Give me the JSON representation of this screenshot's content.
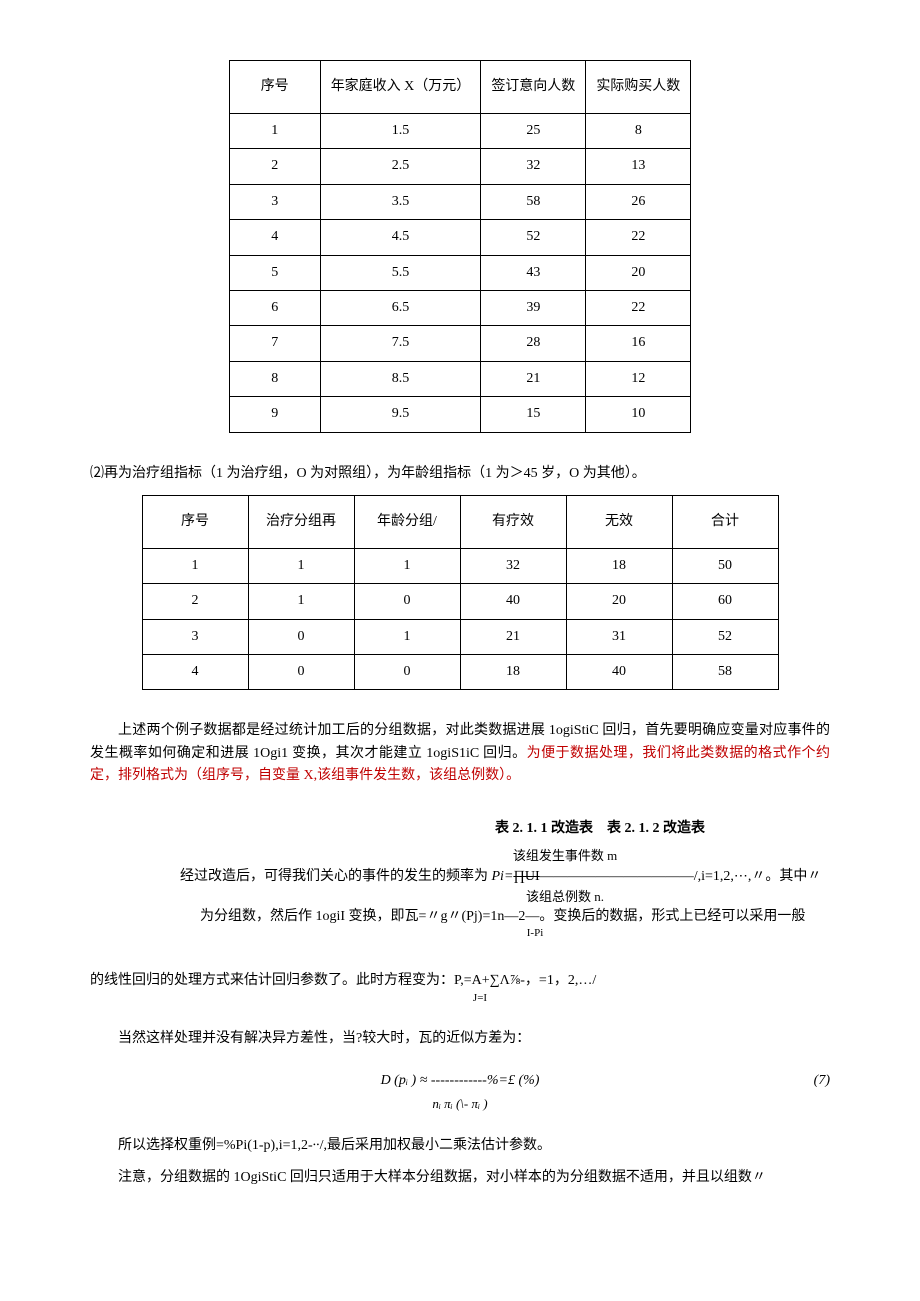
{
  "table1": {
    "headers": [
      "序号",
      "年家庭收入 X（万元）",
      "签订意向人数",
      "实际购买人数"
    ],
    "rows": [
      [
        "1",
        "1.5",
        "25",
        "8"
      ],
      [
        "2",
        "2.5",
        "32",
        "13"
      ],
      [
        "3",
        "3.5",
        "58",
        "26"
      ],
      [
        "4",
        "4.5",
        "52",
        "22"
      ],
      [
        "5",
        "5.5",
        "43",
        "20"
      ],
      [
        "6",
        "6.5",
        "39",
        "22"
      ],
      [
        "7",
        "7.5",
        "28",
        "16"
      ],
      [
        "8",
        "8.5",
        "21",
        "12"
      ],
      [
        "9",
        "9.5",
        "15",
        "10"
      ]
    ]
  },
  "para1": "⑵再为治疗组指标（1 为治疗组，O 为对照组），为年龄组指标（1 为＞45 岁，O 为其他）。",
  "table2": {
    "headers": [
      "序号",
      "治疗分组再",
      "年龄分组/",
      "有疗效",
      "无效",
      "合计"
    ],
    "rows": [
      [
        "1",
        "1",
        "1",
        "32",
        "18",
        "50"
      ],
      [
        "2",
        "1",
        "0",
        "40",
        "20",
        "60"
      ],
      [
        "3",
        "0",
        "1",
        "21",
        "31",
        "52"
      ],
      [
        "4",
        "0",
        "0",
        "18",
        "40",
        "58"
      ]
    ]
  },
  "para2a": "上述两个例子数据都是经过统计加工后的分组数据，对此类数据进展 1ogiStiC 回归，首先要明确应变量对应事件的发生概率如何确定和进展 1Ogi1 变换，其次才能建立 1ogiS1iC 回归。",
  "para2b": "为便于数据处理，我们将此类数据的格式作个约定，排列格式为（组序号，自变量 X,该组事件发生数，该组总例数）。",
  "heading": "表 2. 1. 1 改造表　表 2. 1. 2 改造表",
  "formula_top": "该组发生事件数 m",
  "formula_line1a": "经过改造后，可得我们关心的事件的发生的频率为 ",
  "formula_pi": "Pi=",
  "formula_strike": "∏UI",
  "formula_line1b": "———————————/,i=1,2,⋯,〃。其中〃",
  "formula_bot": "该组总例数 n.",
  "formula_line2": "为分组数，然后作 1ogiI 变换，即瓦=〃g〃(Pj)=1n—2—。变换后的数据，形式上已经可以采用一般",
  "formula_sub": "I-Pi",
  "para3": "的线性回归的处理方式来估计回归参数了。此时方程变为：P,=A+∑Λ⅞-，=1，2,…/",
  "para3sub": "J=I",
  "para4": "当然这样处理并没有解决异方差性，当?较大时，瓦的近似方差为：",
  "eq_main": "D (pᵢ ) ≈ ------------%=£ (%)",
  "eq_sub": "nᵢ πᵢ (\\- πᵢ )",
  "eq_num": "(7)",
  "para5": "所以选择权重例=%Pi(1-p),i=1,2-∙∙/,最后采用加权最小二乘法估计参数。",
  "para6": "注意，分组数据的 1OgiStiC 回归只适用于大样本分组数据，对小样本的为分组数据不适用，并且以组数〃"
}
